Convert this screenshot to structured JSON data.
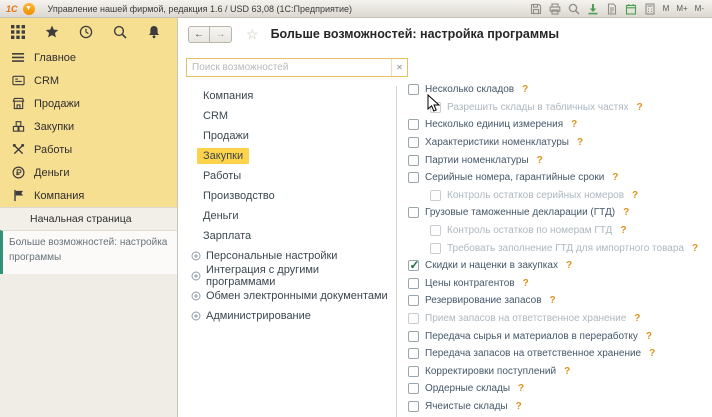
{
  "titlebar": {
    "logo_text": "1С",
    "menu_arrow": "▼",
    "title": "Управление нашей фирмой, редакция 1.6 / USD 63,08  (1С:Предприятие)",
    "toolbar_icons": [
      "save-icon",
      "print-icon",
      "preview-icon",
      "import-icon",
      "print-page-icon",
      "calendar-icon",
      "calculator-icon"
    ],
    "memory_buttons": [
      "M",
      "M+",
      "M-"
    ]
  },
  "sidebar": {
    "top_icons": [
      {
        "name": "menu-grid-icon"
      },
      {
        "name": "favorites-star-icon"
      },
      {
        "name": "history-clock-icon"
      },
      {
        "name": "search-icon"
      },
      {
        "name": "notifications-bell-icon"
      }
    ],
    "menu": [
      {
        "label": "Главное",
        "icon": "hamburger-icon"
      },
      {
        "label": "CRM",
        "icon": "crm-card-icon"
      },
      {
        "label": "Продажи",
        "icon": "sales-shop-icon"
      },
      {
        "label": "Закупки",
        "icon": "purchases-boxes-icon"
      },
      {
        "label": "Работы",
        "icon": "works-tools-icon"
      },
      {
        "label": "Деньги",
        "icon": "money-ruble-icon"
      },
      {
        "label": "Компания",
        "icon": "company-flag-icon"
      }
    ],
    "home_label": "Начальная страница",
    "open_tab_label": "Больше возможностей: настройка программы"
  },
  "header": {
    "back": "←",
    "forward": "→",
    "favorite_star": "☆",
    "title": "Больше возможностей: настройка программы"
  },
  "search": {
    "placeholder": "Поиск возможностей",
    "clear": "✕"
  },
  "nav": {
    "selected": "Закупки",
    "items": [
      {
        "label": "Компания"
      },
      {
        "label": "CRM"
      },
      {
        "label": "Продажи"
      },
      {
        "label": "Закупки",
        "selected": true
      },
      {
        "label": "Работы"
      },
      {
        "label": "Производство"
      },
      {
        "label": "Деньги"
      },
      {
        "label": "Зарплата"
      },
      {
        "label": "Персональные настройки",
        "expandable": true
      },
      {
        "label": "Интеграция с другими программами",
        "expandable": true
      },
      {
        "label": "Обмен электронными документами",
        "expandable": true
      },
      {
        "label": "Администрирование",
        "expandable": true
      }
    ]
  },
  "options": {
    "help_mark": "?",
    "checkmark_color": "#156f42",
    "help_color": "#dd921c",
    "items": [
      {
        "label": "Несколько складов",
        "checked": false,
        "indent": 0,
        "disabled": false
      },
      {
        "label": "Разрешить склады в табличных частях",
        "checked": false,
        "indent": 1,
        "disabled": true
      },
      {
        "label": "Несколько единиц измерения",
        "checked": false,
        "indent": 0,
        "disabled": false
      },
      {
        "label": "Характеристики номенклатуры",
        "checked": false,
        "indent": 0,
        "disabled": false
      },
      {
        "label": "Партии номенклатуры",
        "checked": false,
        "indent": 0,
        "disabled": false
      },
      {
        "label": "Серийные номера, гарантийные сроки",
        "checked": false,
        "indent": 0,
        "disabled": false
      },
      {
        "label": "Контроль остатков серийных номеров",
        "checked": false,
        "indent": 1,
        "disabled": true
      },
      {
        "label": "Грузовые таможенные декларации (ГТД)",
        "checked": false,
        "indent": 0,
        "disabled": false
      },
      {
        "label": "Контроль остатков по номерам ГТД",
        "checked": false,
        "indent": 1,
        "disabled": true
      },
      {
        "label": "Требовать заполнение ГТД для импортного товара",
        "checked": false,
        "indent": 1,
        "disabled": true
      },
      {
        "label": "Скидки и наценки в закупках",
        "checked": true,
        "indent": 0,
        "disabled": false
      },
      {
        "label": "Цены контрагентов",
        "checked": false,
        "indent": 0,
        "disabled": false
      },
      {
        "label": "Резервирование запасов",
        "checked": false,
        "indent": 0,
        "disabled": false
      },
      {
        "label": "Прием запасов на ответственное хранение",
        "checked": false,
        "indent": 0,
        "disabled": true
      },
      {
        "label": "Передача сырья и материалов в переработку",
        "checked": false,
        "indent": 0,
        "disabled": false
      },
      {
        "label": "Передача запасов на ответственное хранение",
        "checked": false,
        "indent": 0,
        "disabled": false
      },
      {
        "label": "Корректировки поступлений",
        "checked": false,
        "indent": 0,
        "disabled": false
      },
      {
        "label": "Ордерные склады",
        "checked": false,
        "indent": 0,
        "disabled": false
      },
      {
        "label": "Ячеистые склады",
        "checked": false,
        "indent": 0,
        "disabled": false
      }
    ]
  }
}
